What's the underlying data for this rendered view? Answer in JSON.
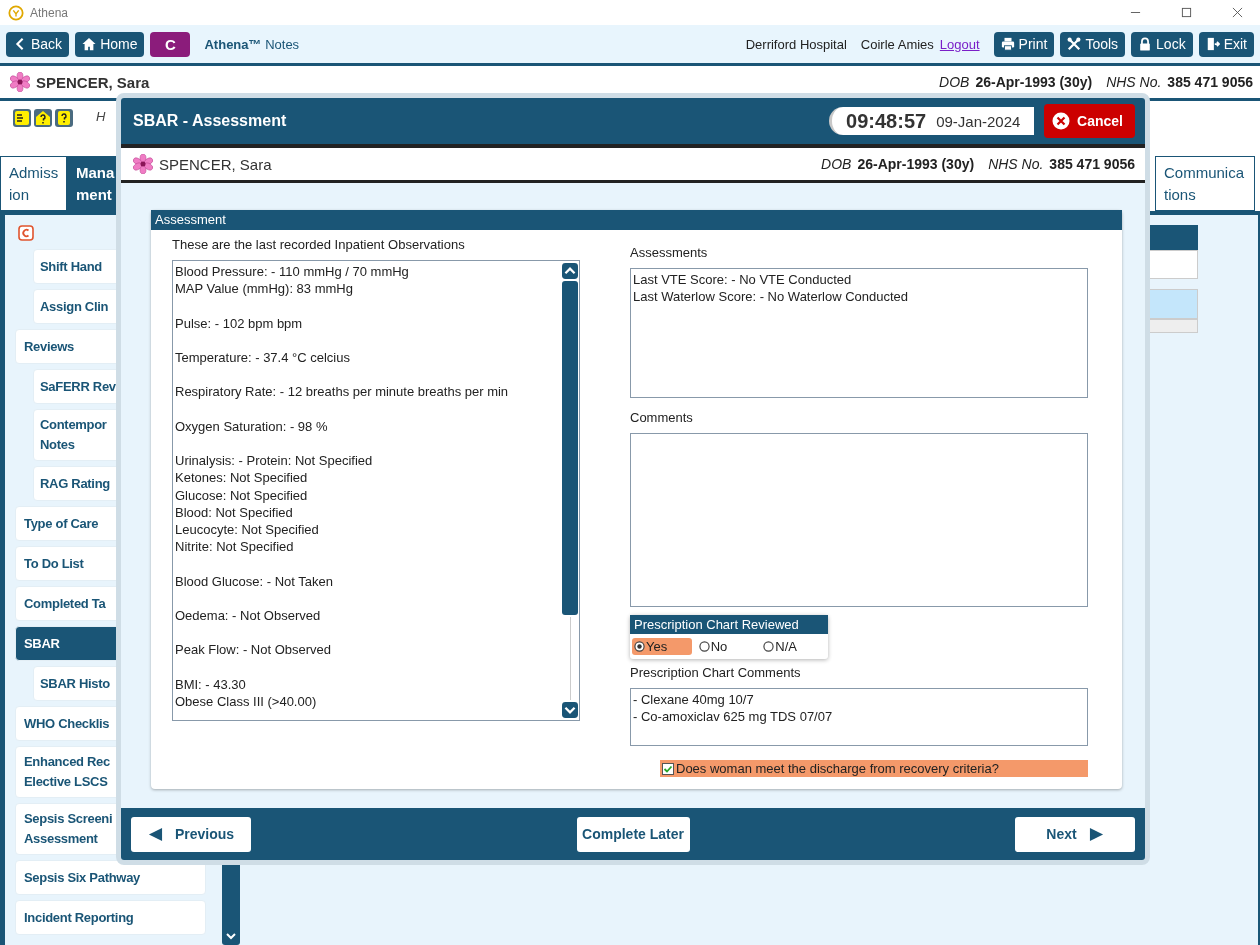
{
  "window": {
    "title": "Athena"
  },
  "toolbar": {
    "back": "Back",
    "home": "Home",
    "badge": "C",
    "brand": "Athena™",
    "brand_suffix": "Notes",
    "hospital": "Derriford Hospital",
    "user": "Coirle Amies",
    "logout": "Logout",
    "buttons": [
      {
        "kind": "print",
        "label": "Print"
      },
      {
        "kind": "tools",
        "label": "Tools"
      },
      {
        "kind": "lock",
        "label": "Lock"
      },
      {
        "kind": "exit",
        "label": "Exit"
      }
    ]
  },
  "patient": {
    "name": "SPENCER, Sara",
    "dob_label": "DOB",
    "dob": "26-Apr-1993 (30y)",
    "nhs_label": "NHS No.",
    "nhs": "385 471 9056"
  },
  "info_row": {
    "text": "H"
  },
  "tabs": [
    {
      "lines": [
        "Admiss",
        "ion"
      ],
      "selected": false
    },
    {
      "lines": [
        "Mana",
        "ment"
      ],
      "selected": true
    },
    {
      "lines": [
        "Communica",
        "tions"
      ],
      "selected": false
    }
  ],
  "sidebar": {
    "items": [
      {
        "lines": [
          "Shift Hand"
        ],
        "sub": true,
        "selected": false
      },
      {
        "lines": [
          "Assign Clin"
        ],
        "sub": true,
        "selected": false
      },
      {
        "lines": [
          "Reviews"
        ],
        "sub": false,
        "selected": false
      },
      {
        "lines": [
          "SaFERR Rev"
        ],
        "sub": true,
        "selected": false
      },
      {
        "lines": [
          "Contempor",
          "Notes"
        ],
        "sub": true,
        "selected": false
      },
      {
        "lines": [
          "RAG Rating"
        ],
        "sub": true,
        "selected": false
      },
      {
        "lines": [
          "Type of Care"
        ],
        "sub": false,
        "selected": false
      },
      {
        "lines": [
          "To Do List"
        ],
        "sub": false,
        "selected": false
      },
      {
        "lines": [
          "Completed Ta"
        ],
        "sub": false,
        "selected": false
      },
      {
        "lines": [
          "SBAR"
        ],
        "sub": false,
        "selected": true
      },
      {
        "lines": [
          "SBAR Histo"
        ],
        "sub": true,
        "selected": false
      },
      {
        "lines": [
          "WHO Checklis"
        ],
        "sub": false,
        "selected": false
      },
      {
        "lines": [
          "Enhanced Rec",
          "Elective LSCS"
        ],
        "sub": false,
        "selected": false
      },
      {
        "lines": [
          "Sepsis Screeni",
          "Assessment"
        ],
        "sub": false,
        "selected": false
      },
      {
        "lines": [
          "Sepsis Six Pathway"
        ],
        "sub": false,
        "selected": false
      },
      {
        "lines": [
          "Incident Reporting"
        ],
        "sub": false,
        "selected": false
      }
    ]
  },
  "dialog": {
    "title": "SBAR - Assessment",
    "time": "09:48:57",
    "date": "09-Jan-2024",
    "cancel": "Cancel",
    "patient": {
      "name": "SPENCER, Sara",
      "dob_label": "DOB",
      "dob": "26-Apr-1993 (30y)",
      "nhs_label": "NHS No.",
      "nhs": "385 471 9056"
    },
    "section": "Assessment",
    "observations_label": "These are the last recorded Inpatient Observations",
    "observations": [
      [
        "Blood Pressure: - 110 mmHg / 70 mmHg",
        "MAP Value (mmHg): 83 mmHg"
      ],
      [
        "Pulse: - 102 bpm bpm"
      ],
      [
        "Temperature: - 37.4 °C celcius"
      ],
      [
        "Respiratory Rate: - 12 breaths per minute breaths per min"
      ],
      [
        "Oxygen Saturation: - 98 %"
      ],
      [
        "Urinalysis: - Protein: Not Specified",
        "Ketones: Not Specified",
        "Glucose: Not Specified",
        "Blood: Not Specified",
        "Leucocyte: Not Specified",
        "Nitrite: Not Specified"
      ],
      [
        "Blood Glucose: - Not Taken"
      ],
      [
        "Oedema: - Not Observed"
      ],
      [
        "Peak Flow: - Not Observed"
      ],
      [
        "BMI: - 43.30",
        "Obese Class III (>40.00)"
      ]
    ],
    "assessments_label": "Assessments",
    "assessments": [
      "Last VTE Score: - No VTE Conducted",
      "Last Waterlow Score: - No Waterlow Conducted"
    ],
    "comments_label": "Comments",
    "reviewed": {
      "title": "Prescription Chart Reviewed",
      "options": [
        {
          "label": "Yes",
          "selected": true
        },
        {
          "label": "No",
          "selected": false
        },
        {
          "label": "N/A",
          "selected": false
        }
      ]
    },
    "prescription_label": "Prescription Chart Comments",
    "prescription_comments": [
      "- Clexane 40mg 10/7",
      "- Co-amoxiclav 625 mg TDS 07/07"
    ],
    "discharge": {
      "label": "Does woman meet the discharge from recovery criteria?",
      "checked": true
    },
    "footer": {
      "previous": "Previous",
      "later": "Complete Later",
      "next": "Next"
    }
  }
}
